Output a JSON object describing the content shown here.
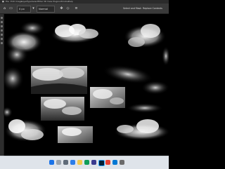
{
  "window": {
    "menu_items": [
      "File",
      "Edit",
      "Image",
      "Layer",
      "Type",
      "Select",
      "Filter",
      "3D",
      "View",
      "Plugins",
      "Window",
      "Help"
    ]
  },
  "options_bar": {
    "feather_value": "0 px",
    "style_label": "Normal",
    "select_and_mask_label": "Select and Mask",
    "content_aware_label": "Replace Contents"
  },
  "canvas": {
    "description_items": [
      "cloud-texture-1",
      "cloud-texture-2",
      "cloud-texture-3",
      "cloud-texture-4",
      "cloud-texture-5",
      "cloud-texture-6",
      "cloud-texture-7",
      "cloud-texture-8",
      "cloud-texture-9",
      "cloud-texture-10",
      "cloud-texture-11",
      "cloud-texture-12",
      "cloud-texture-13"
    ]
  },
  "taskbar": {
    "apps": [
      "start",
      "search",
      "task-view",
      "widgets",
      "file-explorer",
      "edge",
      "store",
      "photoshop",
      "chrome",
      "mail",
      "settings"
    ],
    "tray_time": "",
    "tray_date": ""
  },
  "colors": {
    "app_bg": "#3a3a3a",
    "canvas_bg": "#000000",
    "taskbar_bg": "#dfe4ea",
    "accent": "#1a73e8"
  }
}
